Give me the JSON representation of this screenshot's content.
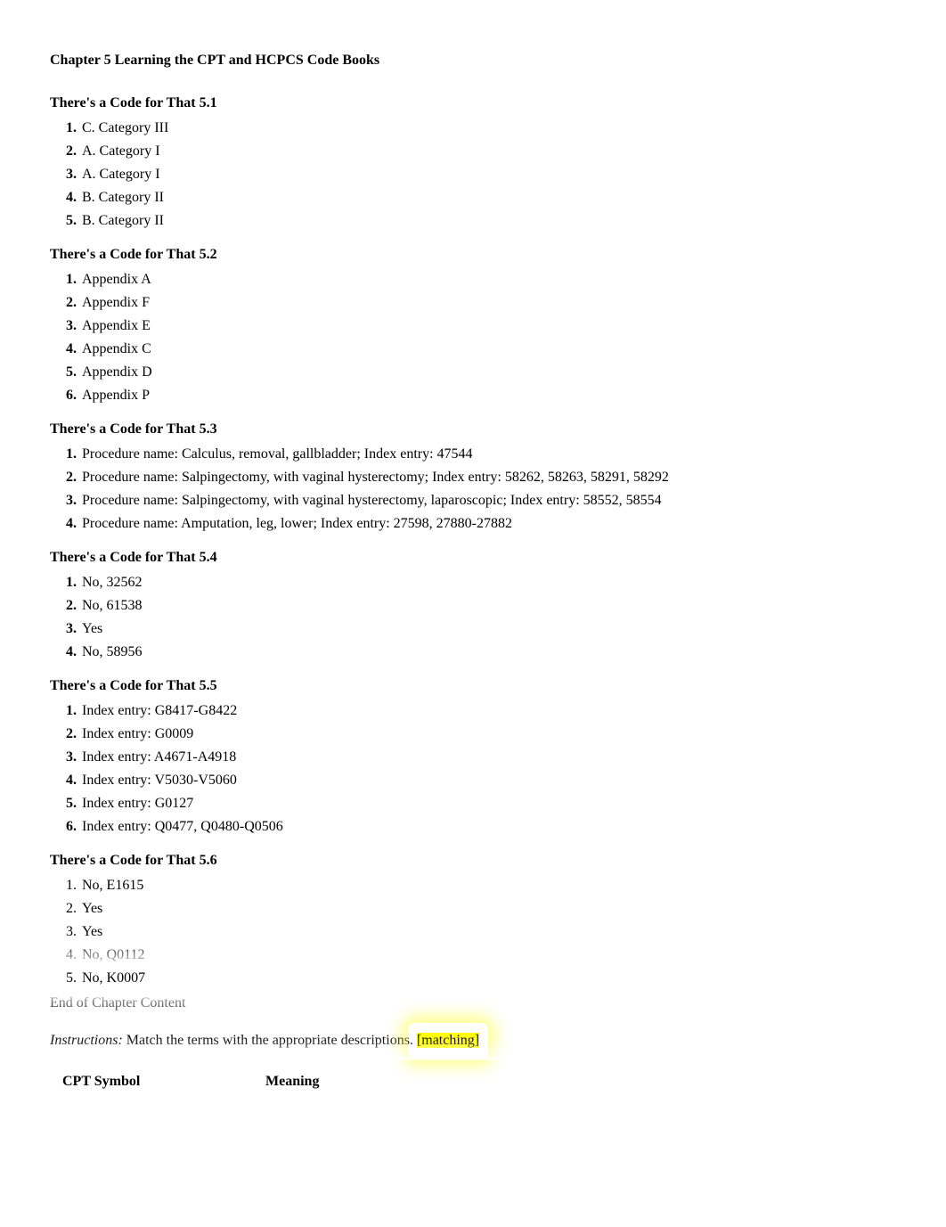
{
  "chapter_title": "Chapter 5 Learning the CPT and HCPCS Code Books",
  "sections": {
    "s1": {
      "title": "There's a Code for That 5.1",
      "items": [
        "C. Category III",
        "A. Category I",
        "A. Category I",
        "B. Category II",
        "B. Category II"
      ]
    },
    "s2": {
      "title": "There's a Code for That 5.2",
      "items": [
        "Appendix A",
        "Appendix F",
        "Appendix E",
        "Appendix C",
        "Appendix D",
        "Appendix P"
      ]
    },
    "s3": {
      "title": "There's a Code for That 5.3",
      "items": [
        "Procedure name: Calculus, removal, gallbladder; Index entry: 47544",
        "Procedure name: Salpingectomy, with vaginal hysterectomy; Index entry: 58262, 58263, 58291, 58292",
        "Procedure name: Salpingectomy, with vaginal hysterectomy, laparoscopic; Index entry: 58552, 58554",
        "Procedure name: Amputation, leg, lower; Index entry: 27598, 27880-27882"
      ]
    },
    "s4": {
      "title": "There's a Code for That 5.4",
      "items": [
        "No, 32562",
        "No, 61538",
        "Yes",
        "No, 58956"
      ]
    },
    "s5": {
      "title": "There's a Code for That 5.5",
      "items": [
        "Index entry: G8417-G8422",
        "Index entry: G0009",
        "Index entry: A4671-A4918",
        "Index entry: V5030-V5060",
        "Index entry: G0127",
        "Index entry: Q0477, Q0480-Q0506"
      ]
    },
    "s6": {
      "title": "There's a Code for That 5.6",
      "items": [
        "No, E1615",
        "Yes",
        "Yes",
        "No, Q0112",
        "No, K0007"
      ]
    }
  },
  "end_of_chapter": "End of Chapter Content",
  "instructions": {
    "label": "Instructions:",
    "text": " Match the terms with the appropriate descriptions. ",
    "tag": "[matching]"
  },
  "table": {
    "headers": [
      "CPT Symbol",
      "Meaning"
    ]
  }
}
